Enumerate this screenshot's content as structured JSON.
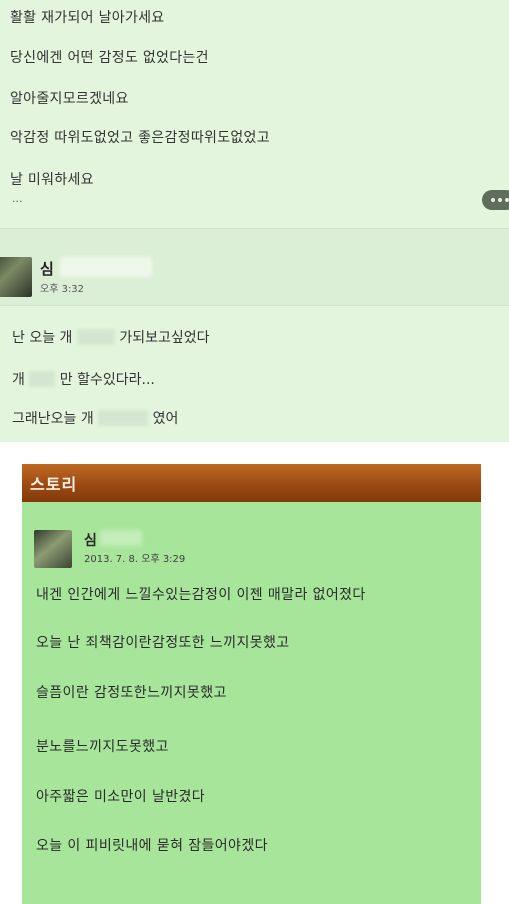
{
  "post": {
    "lines": [
      "활활 재가되어 날아가세요",
      "당신에겐 어떤 감정도 없었다는건",
      "알아줄지모르겠네요",
      "악감정 따위도없었고 좋은감정따위도없었고",
      "날 미워하세요"
    ],
    "ellipsis": "..."
  },
  "comment": {
    "author_initial": "심",
    "time": "오후 3:32",
    "line1": {
      "pre": "난 오늘 개",
      "post": "가되보고싶었다"
    },
    "line2": {
      "pre": "개",
      "post": "만 할수있다라..."
    },
    "line3": {
      "pre": "그래난오늘 개",
      "post": "였어"
    }
  },
  "story": {
    "title": "스토리",
    "author_initial": "심",
    "time": "2013. 7. 8. 오후 3:29",
    "lines": [
      "내겐 인간에게 느낄수있는감정이 이젠 매말라 없어졌다",
      "오늘 난 죄책감이란감정또한 느끼지못했고",
      "슬픔이란 감정또한느끼지못했고",
      "분노를느끼지도못했고",
      "아주짧은 미소만이 날반겼다",
      "오늘 이 피비릿내에 묻혀 잠들어야겠다"
    ]
  },
  "colors": {
    "panel_bg": "#e3f6dd",
    "story_bg": "#a7e59b",
    "story_bar": "#9c4a12"
  }
}
